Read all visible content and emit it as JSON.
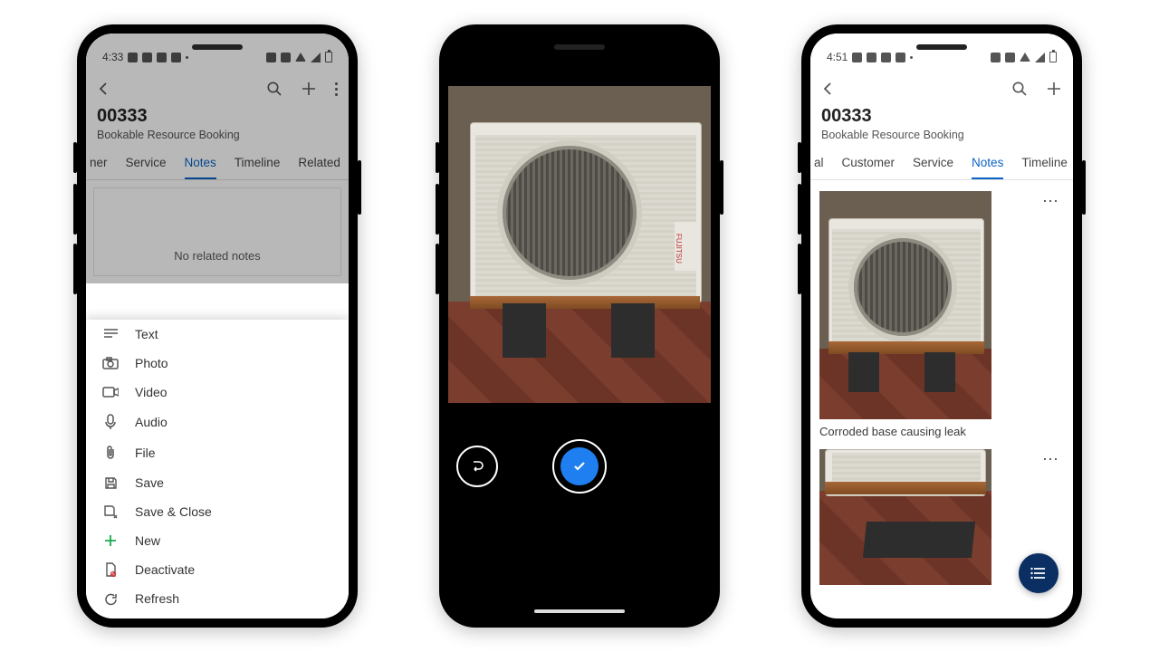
{
  "phone1": {
    "status_time": "4:33",
    "header_title": "00333",
    "header_sub": "Bookable Resource Booking",
    "tabs": [
      "ner",
      "Service",
      "Notes",
      "Timeline",
      "Related"
    ],
    "active_tab": "Notes",
    "empty_text": "No related notes",
    "sheet": {
      "text": "Text",
      "photo": "Photo",
      "video": "Video",
      "audio": "Audio",
      "file": "File",
      "save": "Save",
      "save_close": "Save & Close",
      "new": "New",
      "deactivate": "Deactivate",
      "refresh": "Refresh"
    }
  },
  "phone3": {
    "status_time": "4:51",
    "header_title": "00333",
    "header_sub": "Bookable Resource Booking",
    "tabs": [
      "al",
      "Customer",
      "Service",
      "Notes",
      "Timeline"
    ],
    "active_tab": "Notes",
    "note_caption": "Corroded base causing leak"
  }
}
